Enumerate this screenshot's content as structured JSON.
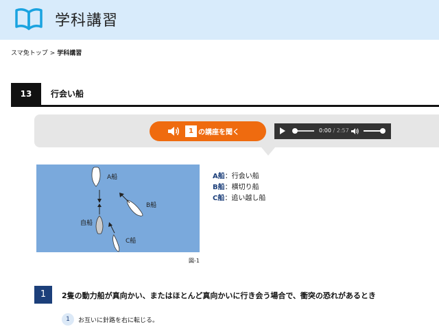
{
  "header": {
    "title": "学科講習",
    "logo_icon": "open-book-icon"
  },
  "breadcrumb": {
    "home": "スマ免トップ",
    "separator": ">",
    "current": "学科講習"
  },
  "lesson": {
    "number": "13",
    "title": "行会い船"
  },
  "audio": {
    "button": {
      "icon": "speaker-icon",
      "number": "1",
      "label": "の講座を聞く"
    },
    "player": {
      "current_time": "0:00",
      "separator": "/",
      "duration": "2:57",
      "progress": 0,
      "volume": 1.0
    }
  },
  "diagram": {
    "labels": {
      "a": "A船",
      "b": "B船",
      "c": "C船",
      "own": "自船"
    },
    "caption": "図-1",
    "colors": {
      "water": "#7aa9dc",
      "own_ship": "#cccccc",
      "other_ship": "#ffffff"
    }
  },
  "legend": [
    {
      "code": "A船",
      "text": "：行会い船"
    },
    {
      "code": "B船",
      "text": "：横切り船"
    },
    {
      "code": "C船",
      "text": "：追い越し船"
    }
  ],
  "question": {
    "number": "1",
    "text": "2隻の動力船が真向かい、またはほとんど真向かいに行き会う場合で、衝突の恐れがあるとき"
  },
  "answers": [
    {
      "number": "1",
      "text": "お互いに針路を右に転じる。"
    }
  ],
  "colors": {
    "header_bg": "#d8ebfb",
    "accent_orange": "#ef6b0f",
    "navy": "#1c3f7a",
    "logo_blue": "#1aa3e0"
  }
}
